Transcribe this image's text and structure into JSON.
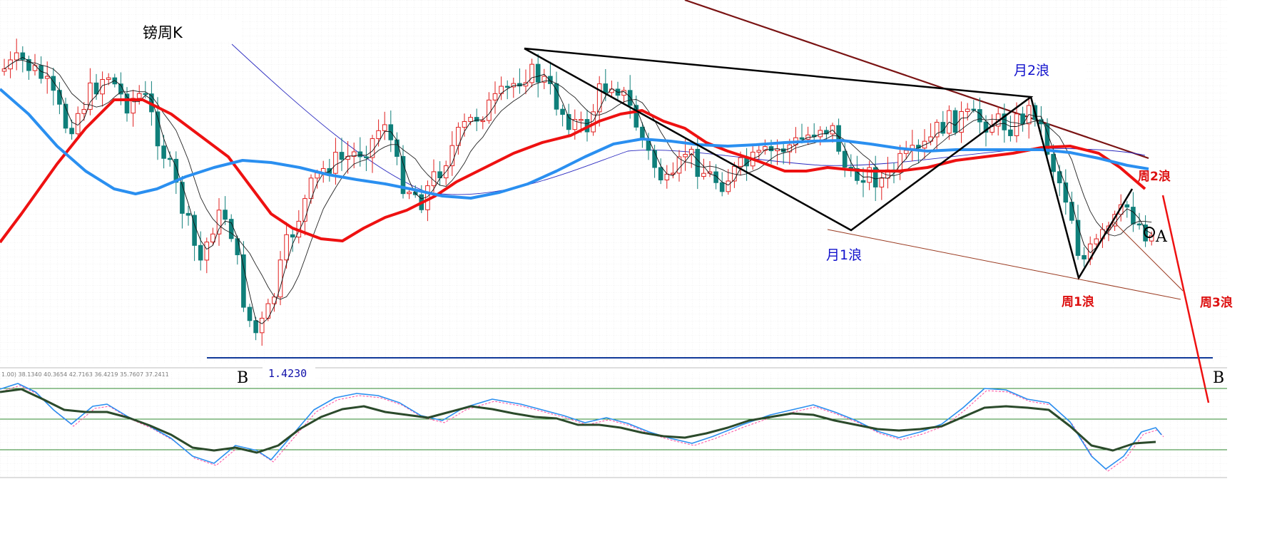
{
  "chart_title": "镑周K",
  "indicator_header": "1.00) 38.1340 40.3654 42.7163 36.4219 35.7607 37.2411",
  "price_level_label": "1.4230",
  "annotations": {
    "month_wave_1": "月1浪",
    "month_wave_2": "月2浪",
    "week_wave_1": "周1浪",
    "week_wave_2": "周2浪",
    "week_wave_3": "周3浪",
    "point_a": "A",
    "point_b_left": "B",
    "point_b_right": "B"
  },
  "colors": {
    "up_candle": "#e0201f",
    "down_candle": "#0f7f7a",
    "ma_red": "#ee1111",
    "ma_blue": "#2a8ff0",
    "thin_navy_ma": "#2b2bc0",
    "dark_red_trend": "#7a1313",
    "wave_lines": "#000000",
    "forecast": "#ee1111",
    "support_line": "#123a9a",
    "stoch_main": "#2a8ff0",
    "stoch_signal": "#2b4a2b",
    "stoch_levels": "#2f8a2f",
    "grid": "#d4d4d4",
    "month_label": "#1111cc",
    "week_label": "#dd1111"
  },
  "chart_data": {
    "type": "candlestick",
    "support_level": 1.423,
    "stochastic_levels": [
      80,
      50,
      20
    ],
    "moving_averages": [
      "red",
      "blue",
      "navy-thin",
      "black-thin-fast",
      "black-thin-slow"
    ]
  }
}
